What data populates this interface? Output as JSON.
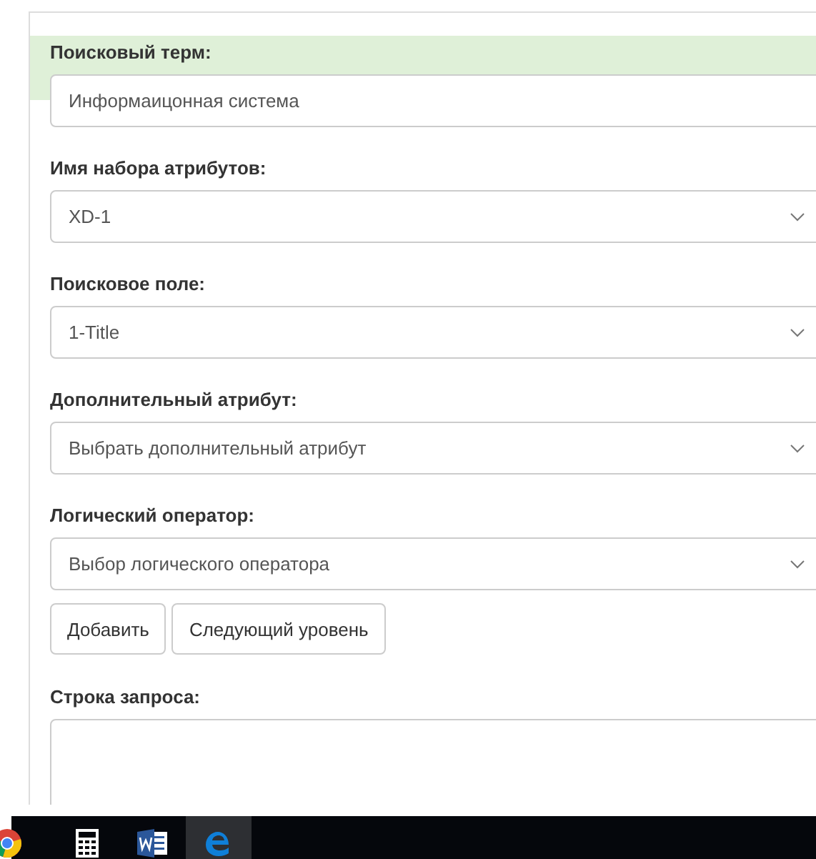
{
  "fields": [
    {
      "label": "Поисковый терм:",
      "kind": "input",
      "value": "Информаицонная система"
    },
    {
      "label": "Имя набора атрибутов:",
      "kind": "select",
      "value": "XD-1"
    },
    {
      "label": "Поисковое поле:",
      "kind": "select",
      "value": "1-Title"
    },
    {
      "label": "Дополнительный атрибут:",
      "kind": "select",
      "value": "Выбрать дополнительный атрибут"
    },
    {
      "label": "Логический оператор:",
      "kind": "select",
      "value": "Выбор логического оператора"
    }
  ],
  "buttons": [
    "Добавить",
    "Следующий уровень"
  ],
  "query": {
    "label": "Строка запроса:"
  },
  "taskbar": [
    {
      "kind": "browser",
      "selected": false
    },
    {
      "kind": "calculator",
      "selected": false
    },
    {
      "kind": "word",
      "selected": false
    },
    {
      "kind": "edge",
      "selected": true
    }
  ]
}
